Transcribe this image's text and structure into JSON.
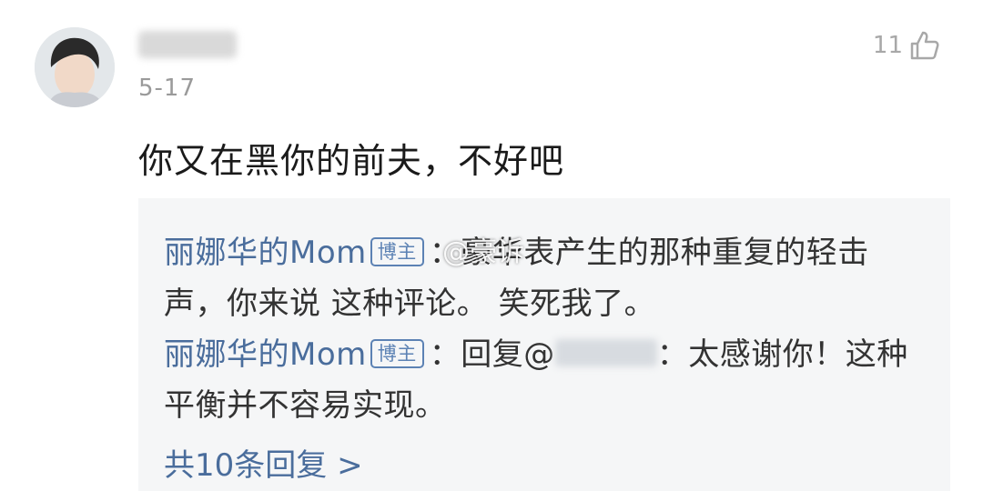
{
  "comment": {
    "date": "5-17",
    "like_count": "11",
    "text": "你又在黑你的前夫，不好吧"
  },
  "replies": [
    {
      "author": "丽娜华的Mom",
      "badge": "博主",
      "text": "：豪华表产生的那种重复的轻击声，你来说 这种评论。 笑死我了。"
    },
    {
      "author": "丽娜华的Mom",
      "badge": "博主",
      "text_prefix": "：回复@",
      "text_suffix": "：太感谢你！这种平衡并不容易实现。"
    }
  ],
  "more_replies_label": "共10条回复 >",
  "watermark": "@豪诉",
  "icons": {
    "like": "thumbs-up-icon",
    "avatar": "user-avatar"
  },
  "colors": {
    "link": "#4a6d9c",
    "muted": "#9a9a9a",
    "reply_bg": "#f5f6f7"
  }
}
